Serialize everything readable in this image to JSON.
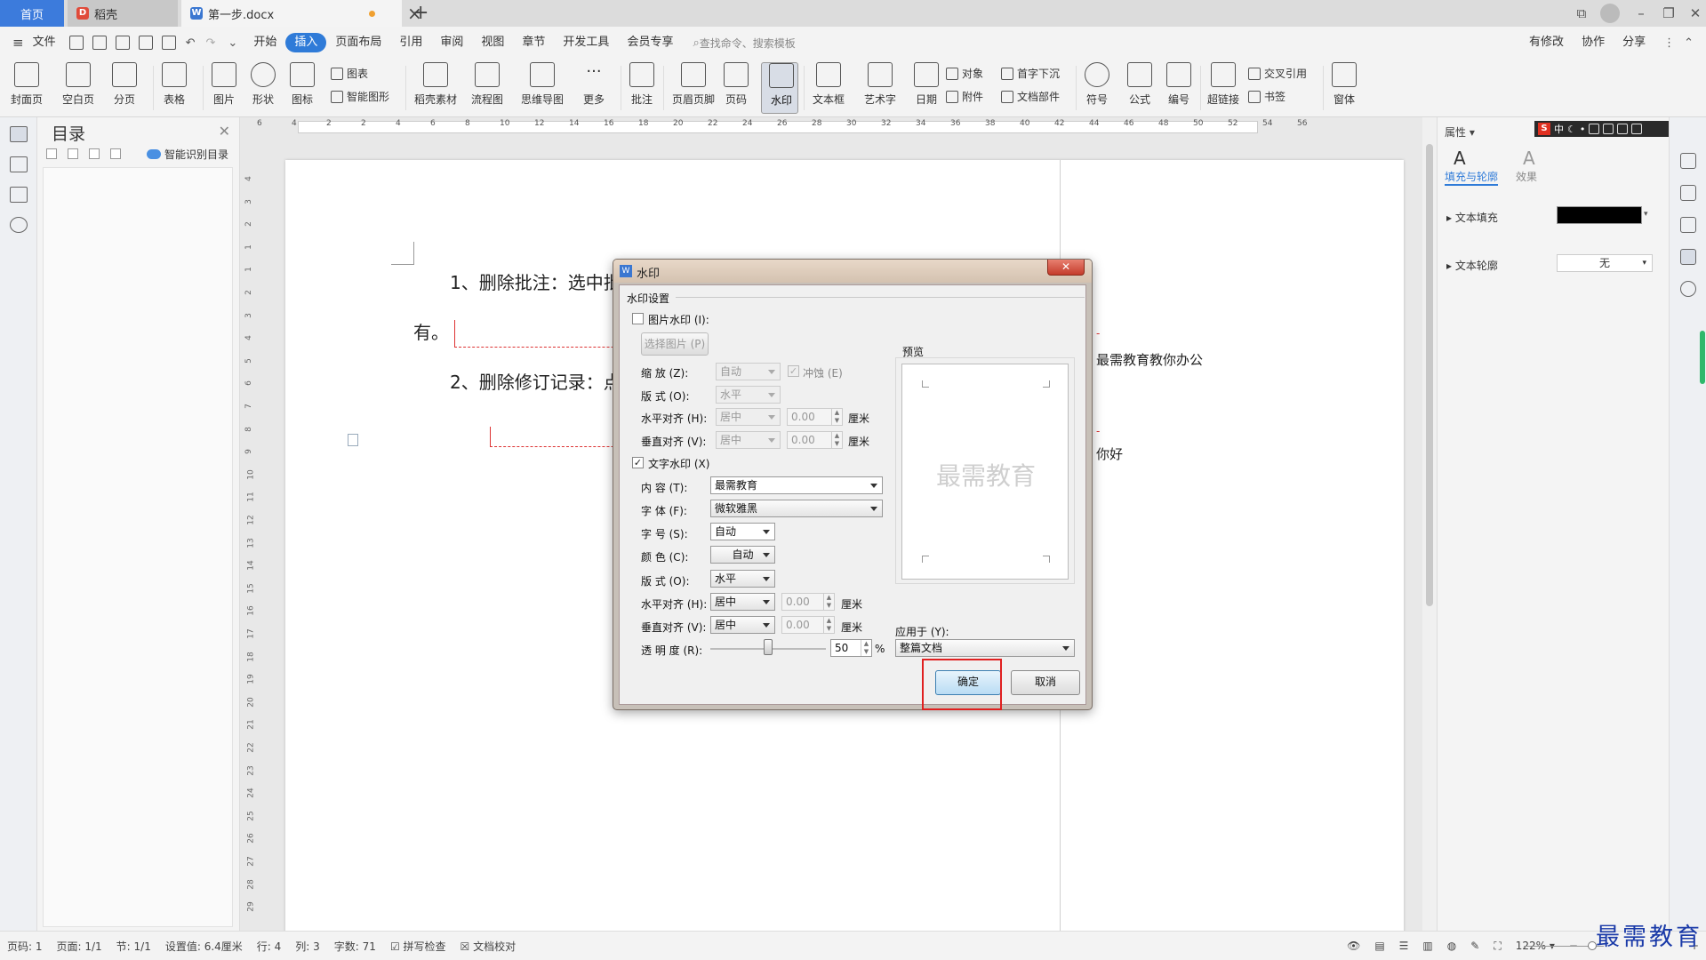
{
  "titlebar": {
    "tabs": [
      {
        "label": "首页"
      },
      {
        "label": "稻壳"
      },
      {
        "label": "第一步.docx"
      }
    ]
  },
  "menu": {
    "file": "文件",
    "items": [
      "开始",
      "插入",
      "页面布局",
      "引用",
      "审阅",
      "视图",
      "章节",
      "开发工具",
      "会员专享"
    ],
    "active": "插入",
    "search": "查找命令、搜索模板",
    "right": [
      "有修改",
      "协作",
      "分享"
    ]
  },
  "ribbon": {
    "big": [
      "封面页",
      "空白页",
      "分页",
      "表格",
      "图片",
      "形状",
      "图标",
      "稻壳素材",
      "流程图",
      "思维导图",
      "更多",
      "批注",
      "页眉页脚",
      "页码",
      "水印",
      "文本框",
      "艺术字",
      "日期",
      "编号",
      "符号",
      "公式",
      "超链接",
      "窗体"
    ],
    "small": {
      "chart": "图表",
      "smart": "智能图形",
      "object": "对象",
      "dropcap": "首字下沉",
      "attach": "附件",
      "docpart": "文档部件",
      "xref": "交叉引用",
      "bookmark": "书签"
    }
  },
  "toc": {
    "title": "目录",
    "smart": "智能识别目录"
  },
  "ruler": {
    "h": [
      "6",
      "4",
      "2",
      "2",
      "4",
      "6",
      "8",
      "10",
      "12",
      "14",
      "16",
      "18",
      "20",
      "22",
      "24",
      "26",
      "28",
      "30",
      "32",
      "34",
      "36",
      "38",
      "40",
      "42",
      "44",
      "46",
      "48",
      "50",
      "52",
      "54",
      "56"
    ],
    "v": [
      "4",
      "3",
      "2",
      "1",
      "1",
      "2",
      "3",
      "4",
      "5",
      "6",
      "7",
      "8",
      "9",
      "10",
      "11",
      "12",
      "13",
      "14",
      "15",
      "16",
      "17",
      "18",
      "19",
      "20",
      "21",
      "22",
      "23",
      "24",
      "25",
      "26",
      "27",
      "28",
      "29"
    ]
  },
  "doc": {
    "line1": "1、删除批注：选中批",
    "line2": "有。",
    "line3": "2、删除修订记录：点",
    "note1": "最需教育教你办公",
    "note2": "你好"
  },
  "rightpanel": {
    "title": "属性",
    "tab1": "填充与轮廓",
    "tab2": "效果",
    "fill": "文本填充",
    "outline": "文本轮廓",
    "outline_val": "无",
    "fill_color": "#000000"
  },
  "ime": {
    "items": [
      "中",
      "☾",
      "•"
    ]
  },
  "statusbar": {
    "page": "页码: 1",
    "pages": "页面: 1/1",
    "section": "节: 1/1",
    "setval": "设置值: 6.4厘米",
    "row": "行: 4",
    "col": "列: 3",
    "words": "字数: 71",
    "spell": "拼写检查",
    "proof": "文档校对",
    "zoom": "122%"
  },
  "dialog": {
    "title": "水印",
    "group": "水印设置",
    "pic_wm": "图片水印 (I):",
    "select_pic": "选择图片 (P)",
    "scale": "缩 放 (Z):",
    "scale_val": "自动",
    "washout": "冲蚀 (E)",
    "layout": "版 式 (O):",
    "layout_val": "水平",
    "halign": "水平对齐 (H):",
    "valign": "垂直对齐 (V):",
    "align_val": "居中",
    "num_val": "0.00",
    "unit": "厘米",
    "text_wm": "文字水印 (X)",
    "content": "内 容 (T):",
    "content_val": "最需教育",
    "font": "字 体 (F):",
    "font_val": "微软雅黑",
    "size": "字 号 (S):",
    "size_val": "自动",
    "color": "颜 色 (C):",
    "color_val": "自动",
    "layout2": "版 式 (O):",
    "layout2_val": "水平",
    "halign2": "水平对齐 (H):",
    "valign2": "垂直对齐 (V):",
    "align2_val": "居中",
    "num2_val": "0.00",
    "unit2": "厘米",
    "trans": "透 明 度 (R):",
    "trans_val": "50",
    "percent": "%",
    "trans_fraction": 0.5,
    "preview": "预览",
    "preview_wm": "最需教育",
    "apply": "应用于 (Y):",
    "apply_val": "整篇文档",
    "ok": "确定",
    "cancel": "取消"
  },
  "brand": "最需教育"
}
